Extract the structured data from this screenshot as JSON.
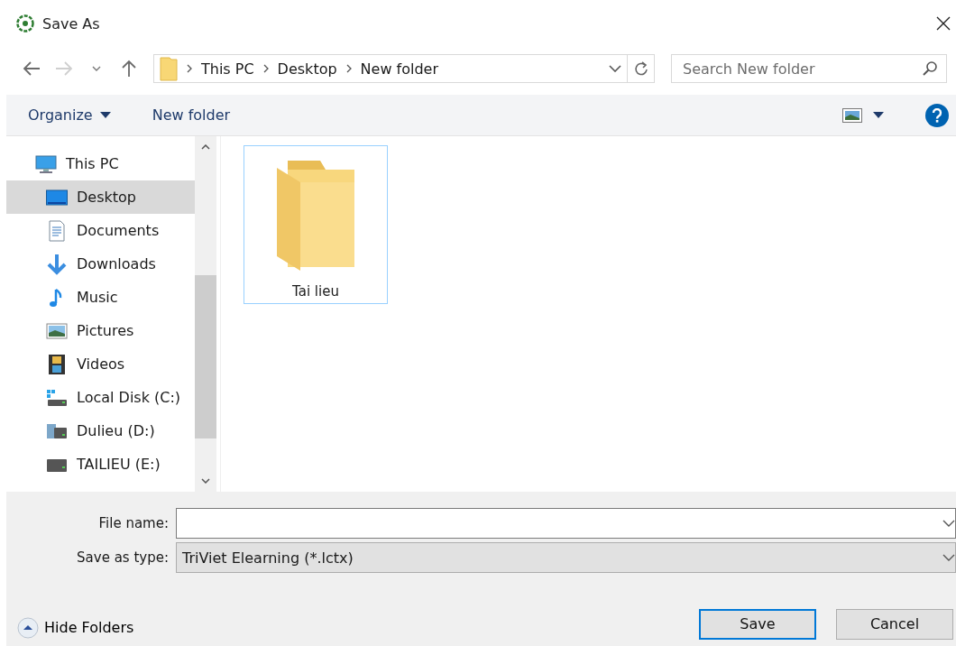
{
  "window": {
    "title": "Save As"
  },
  "address_bar": {
    "path": [
      "This PC",
      "Desktop",
      "New folder"
    ]
  },
  "search": {
    "placeholder": "Search New folder"
  },
  "toolbar": {
    "items": [
      "Organize",
      "New folder"
    ]
  },
  "sidebar": {
    "items": [
      {
        "label": "This PC",
        "kind": "pc",
        "selected": false,
        "children": [
          {
            "label": "Desktop",
            "kind": "desktop",
            "selected": true
          },
          {
            "label": "Documents",
            "kind": "documents",
            "selected": false
          },
          {
            "label": "Downloads",
            "kind": "downloads",
            "selected": false
          },
          {
            "label": "Music",
            "kind": "music",
            "selected": false
          },
          {
            "label": "Pictures",
            "kind": "pictures",
            "selected": false
          },
          {
            "label": "Videos",
            "kind": "videos",
            "selected": false
          },
          {
            "label": "Local Disk (C:)",
            "kind": "system-disk",
            "selected": false
          },
          {
            "label": "Dulieu (D:)",
            "kind": "media-drive",
            "selected": false
          },
          {
            "label": "TAILIEU (E:)",
            "kind": "drive",
            "selected": false
          }
        ]
      }
    ]
  },
  "files": [
    {
      "name": "Tai lieu",
      "selected": true
    }
  ],
  "form": {
    "file_name": {
      "label": "File name:"
    },
    "save_as_type": {
      "label": "Save as type:",
      "value": "TriViet Elearning (*.lctx)"
    }
  },
  "hide_folders": "Hide Folders",
  "buttons": [
    {
      "label": "Save",
      "default": true
    },
    {
      "label": "Cancel",
      "default": false
    }
  ]
}
